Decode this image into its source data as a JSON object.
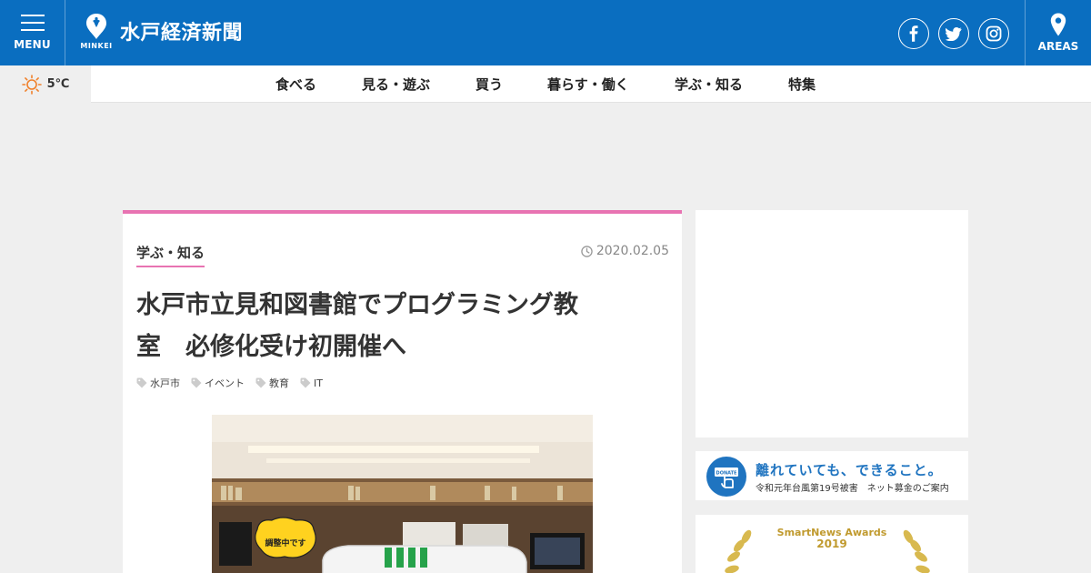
{
  "header": {
    "menu_label": "MENU",
    "site_title": "水戸経済新聞",
    "logo_sub": "MINKEI",
    "areas_label": "AREAS",
    "social": [
      "facebook-icon",
      "twitter-icon",
      "instagram-icon"
    ],
    "brand_color": "#0a6ec0"
  },
  "weather": {
    "temp": "5℃",
    "icon": "sun-icon"
  },
  "nav": {
    "items": [
      "食べる",
      "見る・遊ぶ",
      "買う",
      "暮らす・働く",
      "学ぶ・知る",
      "特集"
    ]
  },
  "article": {
    "category": "学ぶ・知る",
    "date": "2020.02.05",
    "title_line1": "水戸市立見和図書館でプログラミング教",
    "title_line2": "室　必修化受け初開催へ",
    "tags": [
      "水戸市",
      "イベント",
      "教育",
      "IT"
    ],
    "accent_color": "#e873b2",
    "photo_sign": "調整中です"
  },
  "sidebar": {
    "donate_badge": "DONATE",
    "donate_main": "離れていても、できること。",
    "donate_sub": "令和元年台風第19号被害　ネット募金のご案内",
    "awards_title": "SmartNews Awards",
    "awards_year": "2019"
  }
}
